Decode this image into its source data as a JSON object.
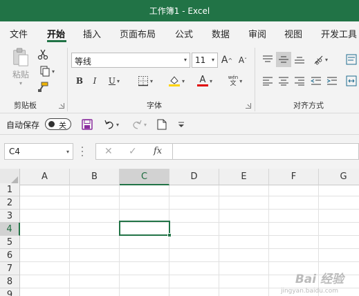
{
  "window": {
    "title": "工作簿1  -  Excel"
  },
  "tabs": [
    "文件",
    "开始",
    "插入",
    "页面布局",
    "公式",
    "数据",
    "审阅",
    "视图",
    "开发工具"
  ],
  "active_tab": "开始",
  "ribbon": {
    "clipboard": {
      "paste_label": "粘贴",
      "group_label": "剪贴板"
    },
    "font": {
      "name": "等线",
      "size": "11",
      "bold": "B",
      "italic": "I",
      "underline": "U",
      "phonetic_top": "wén",
      "phonetic_bottom": "文",
      "group_label": "字体",
      "grow_label": "A",
      "shrink_label": "A",
      "font_color_label": "A"
    },
    "alignment": {
      "group_label": "对齐方式"
    }
  },
  "qat": {
    "autosave_label": "自动保存",
    "autosave_state": "关"
  },
  "formula_bar": {
    "name_box": "C4",
    "fx": "fx",
    "value": ""
  },
  "grid": {
    "columns": [
      "A",
      "B",
      "C",
      "D",
      "E",
      "F",
      "G"
    ],
    "rows": [
      "1",
      "2",
      "3",
      "4",
      "5",
      "6",
      "7",
      "8",
      "9"
    ],
    "selected_column": "C",
    "selected_row": "4"
  },
  "watermark": {
    "text": "Bai 经验",
    "sub": "jingyan.baidu.com"
  },
  "colors": {
    "accent": "#217346",
    "fill_yellow": "#ffd400",
    "font_red": "#e00000",
    "save_purple": "#8a2d9e"
  }
}
